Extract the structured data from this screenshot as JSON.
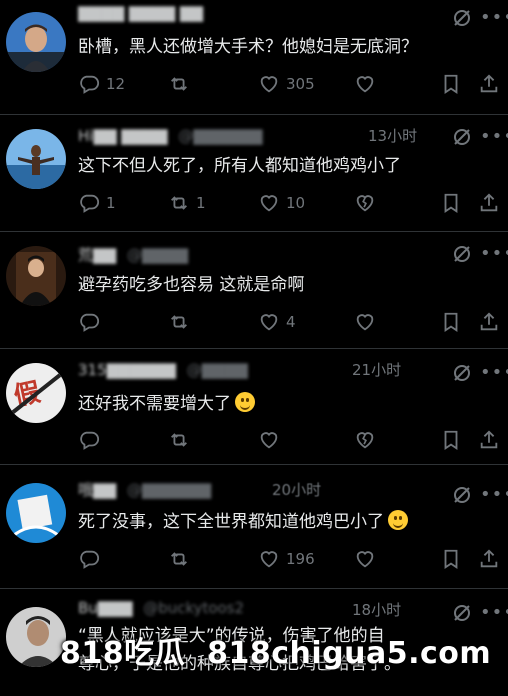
{
  "replies": [
    {
      "text": "卧槽，黑人还做增大手术？他媳妇是无底洞？",
      "counts": {
        "reply": "12",
        "repost": "",
        "like": "305"
      },
      "broken_heart": false
    },
    {
      "text": "这下不但人死了，所有人都知道他鸡鸡小了",
      "counts": {
        "reply": "1",
        "repost": "1",
        "like": "10"
      },
      "broken_heart": true,
      "time": "13小时"
    },
    {
      "text": "避孕药吃多也容易 这就是命啊",
      "counts": {
        "reply": "",
        "repost": "",
        "like": "4"
      },
      "broken_heart": false
    },
    {
      "text": "还好我不需要增大了",
      "counts": {
        "reply": "",
        "repost": "",
        "like": ""
      },
      "broken_heart": true,
      "time": "21小时"
    },
    {
      "text": "死了没事，这下全世界都知道他鸡巴小了",
      "counts": {
        "reply": "",
        "repost": "",
        "like": "196"
      },
      "broken_heart": false,
      "time": "20小时"
    },
    {
      "text_line1": "“黑人就应该是大”的传说，伤害了他的自",
      "text_line2": "尊心，于是他的种族自尊心把鸡巴给害了。",
      "handle": "@buckytoos2",
      "time": "18小时"
    }
  ],
  "watermark": {
    "left": "818吃瓜",
    "right": "818chigua5.com"
  },
  "colors": {
    "bg": "#000000",
    "text": "#e7e9ea",
    "muted": "#71767b",
    "divider": "#2f3336"
  }
}
